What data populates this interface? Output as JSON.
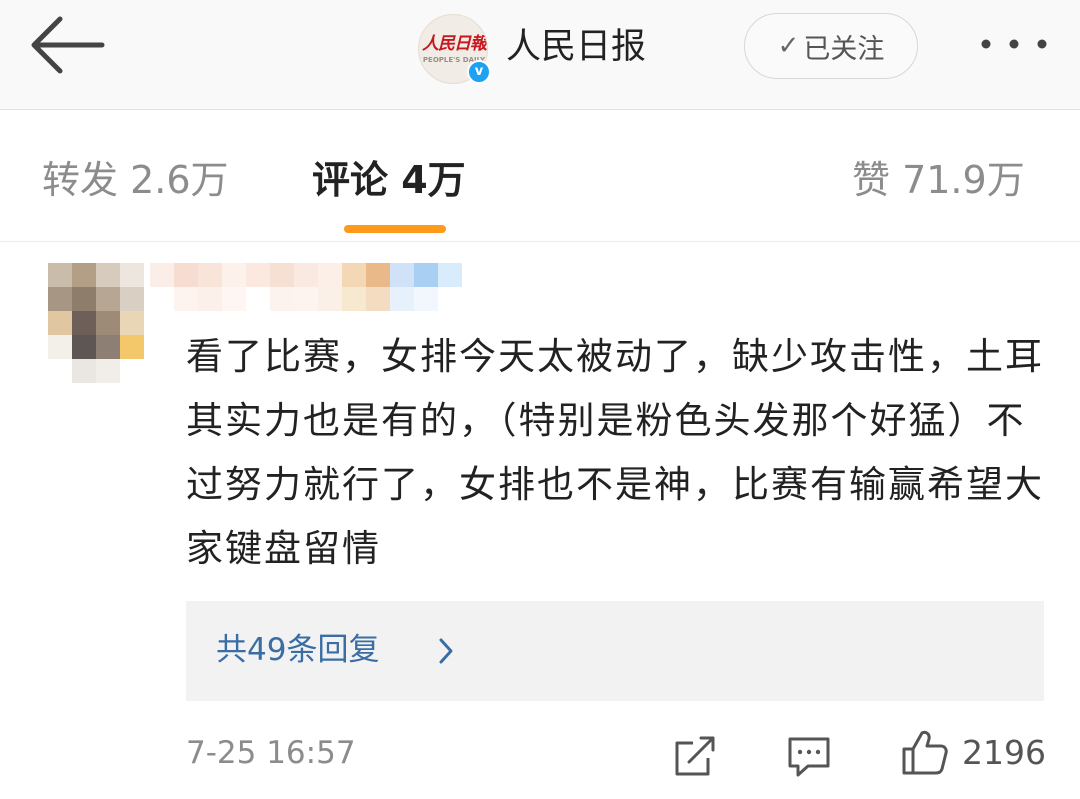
{
  "header": {
    "logo_text": "人民日報",
    "logo_text_en": "PEOPLE'S DAILY",
    "account_name": "人民日报",
    "verified_mark": "v",
    "follow_label": "已关注",
    "follow_check": "✓",
    "icons": {
      "back": "back-arrow-icon",
      "more": "more-dots-icon",
      "verified": "verified-badge-icon"
    }
  },
  "tabs": {
    "repost": "转发 2.6万",
    "comments": "评论 4万",
    "likes": "赞 71.9万",
    "active": "comments",
    "indicator_color": "#ff9a1a"
  },
  "comment": {
    "text": "看了比赛，女排今天太被动了，缺少攻击性，土耳其实力也是有的，（特别是粉色头发那个好猛）不过努力就行了，女排也不是神，比赛有输赢希望大家键盘留情",
    "reply_link": "共49条回复",
    "timestamp": "7-25 16:57",
    "like_count": "2196",
    "icons": {
      "repost": "share-edit-icon",
      "reply": "comment-bubble-icon",
      "like": "thumbs-up-icon",
      "reply_chevron": "chevron-right-icon"
    }
  },
  "colors": {
    "accent": "#ff9a1a",
    "link": "#3b6da5",
    "verified": "#1da1f2",
    "logo_red": "#c8161e"
  }
}
